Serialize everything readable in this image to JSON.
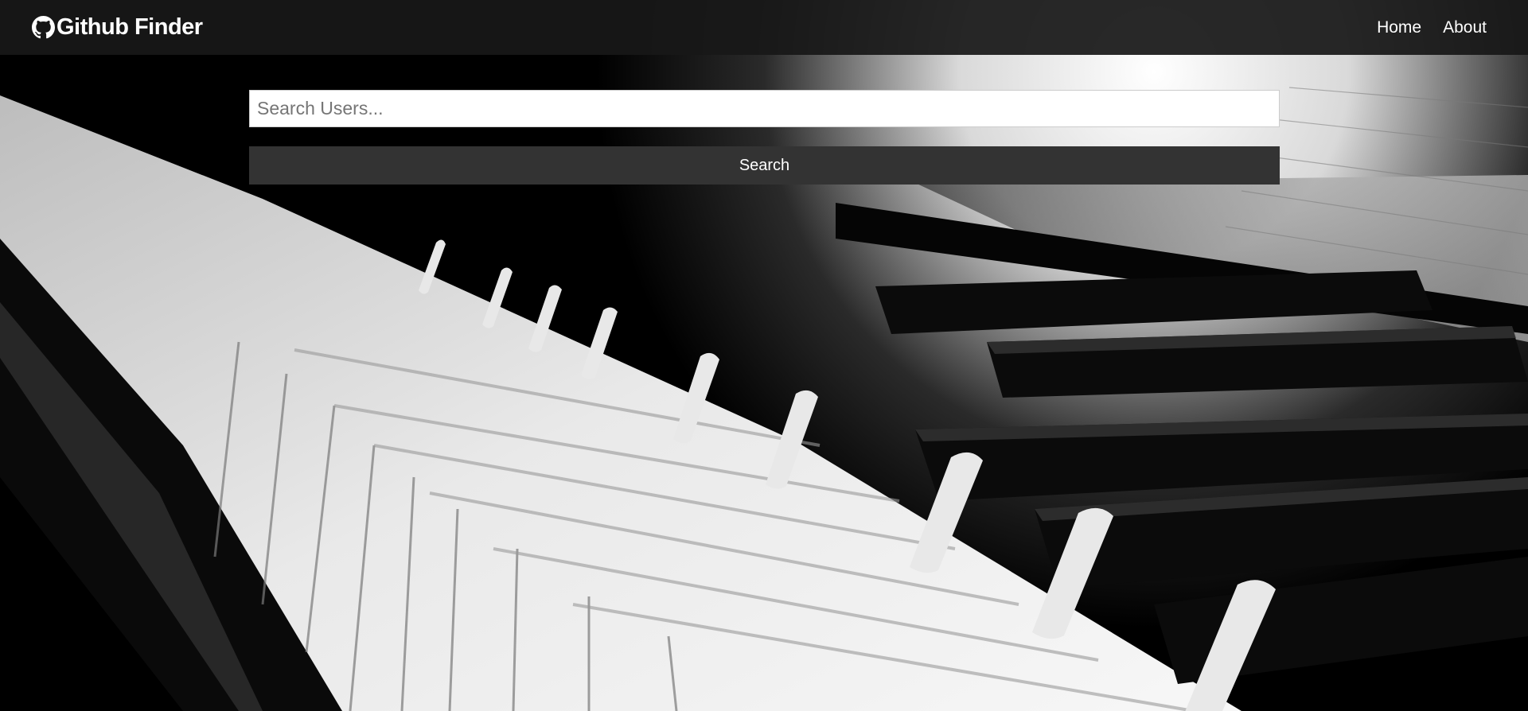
{
  "brand": {
    "title": "Github Finder",
    "icon": "github-icon"
  },
  "nav": {
    "links": [
      {
        "label": "Home"
      },
      {
        "label": "About"
      }
    ]
  },
  "search": {
    "placeholder": "Search Users...",
    "value": "",
    "button_label": "Search"
  },
  "background": {
    "description_icon": "piano-keys-background",
    "colors": {
      "navbar": "#181818",
      "button": "#333333"
    }
  }
}
